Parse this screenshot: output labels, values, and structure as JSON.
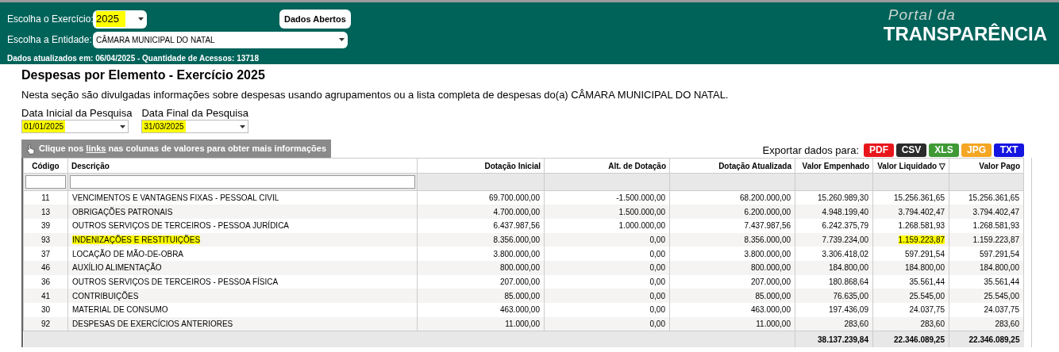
{
  "header": {
    "year_label": "Escolha o Exercício:",
    "year": {
      "value": "2025",
      "highlighted": true
    },
    "open_data_button": "Dados Abertos",
    "entity_label": "Escolha a Entidade:",
    "entity": "CÂMARA MUNICIPAL DO NATAL",
    "updated_info": "Dados atualizados em: 06/04/2025 - Quantidade de Acessos: 13718",
    "logo_small": "Portal da",
    "logo_large": "TRANSPARÊNCIA"
  },
  "page": {
    "title": "Despesas por Elemento - Exercício 2025",
    "description": "Nesta seção são divulgadas informações sobre despesas usando agrupamentos ou a lista completa de despesas do(a) CÂMARA MUNICIPAL DO NATAL.",
    "date_fields": [
      {
        "label": "Data Inicial da Pesquisa",
        "value": "01/01/2025",
        "highlighted": true
      },
      {
        "label": "Data Final da Pesquisa",
        "value": "31/03/2025",
        "highlighted": true
      }
    ],
    "hint": {
      "before": "Clique nos",
      "link": "links",
      "after": "nas colunas de valores para obter mais informações"
    },
    "export_label": "Exportar dados para:",
    "export_buttons": [
      {
        "label": "PDF",
        "color": "#e8161b"
      },
      {
        "label": "CSV",
        "color": "#2b2b2b"
      },
      {
        "label": "XLS",
        "color": "#3f9a35"
      },
      {
        "label": "JPG",
        "color": "#f5a623"
      },
      {
        "label": "TXT",
        "color": "#1515e0"
      }
    ]
  },
  "table": {
    "columns": [
      {
        "label": "Código",
        "sorted": false,
        "filter": true
      },
      {
        "label": "Descrição",
        "sorted": false,
        "filter": true
      },
      {
        "label": "Dotação Inicial",
        "sorted": false,
        "filter": false
      },
      {
        "label": "Alt. de Dotação",
        "sorted": false,
        "filter": false
      },
      {
        "label": "Dotação Atualizada",
        "sorted": false,
        "filter": false
      },
      {
        "label": "Valor Empenhado",
        "sorted": false,
        "filter": false
      },
      {
        "label": "Valor Liquidado",
        "sorted": true,
        "filter": false
      },
      {
        "label": "Valor Pago",
        "sorted": false,
        "filter": false
      }
    ],
    "sort_indicator": "▽",
    "rows": [
      {
        "cells": [
          {
            "text": "11",
            "highlighted": false
          },
          {
            "text": "VENCIMENTOS E VANTAGENS FIXAS - PESSOAL CIVIL",
            "highlighted": false
          },
          {
            "text": "69.700.000,00",
            "highlighted": false
          },
          {
            "text": "-1.500.000,00",
            "highlighted": false
          },
          {
            "text": "68.200.000,00",
            "highlighted": false
          },
          {
            "text": "15.260.989,30",
            "highlighted": false
          },
          {
            "text": "15.256.361,65",
            "highlighted": false
          },
          {
            "text": "15.256.361,65",
            "highlighted": false
          }
        ]
      },
      {
        "cells": [
          {
            "text": "13",
            "highlighted": false
          },
          {
            "text": "OBRIGAÇÕES PATRONAIS",
            "highlighted": false
          },
          {
            "text": "4.700.000,00",
            "highlighted": false
          },
          {
            "text": "1.500.000,00",
            "highlighted": false
          },
          {
            "text": "6.200.000,00",
            "highlighted": false
          },
          {
            "text": "4.948.199,40",
            "highlighted": false
          },
          {
            "text": "3.794.402,47",
            "highlighted": false
          },
          {
            "text": "3.794.402,47",
            "highlighted": false
          }
        ]
      },
      {
        "cells": [
          {
            "text": "39",
            "highlighted": false
          },
          {
            "text": "OUTROS SERVIÇOS DE TERCEIROS - PESSOA JURÍDICA",
            "highlighted": false
          },
          {
            "text": "6.437.987,56",
            "highlighted": false
          },
          {
            "text": "1.000.000,00",
            "highlighted": false
          },
          {
            "text": "7.437.987,56",
            "highlighted": false
          },
          {
            "text": "6.242.375,79",
            "highlighted": false
          },
          {
            "text": "1.268.581,93",
            "highlighted": false
          },
          {
            "text": "1.268.581,93",
            "highlighted": false
          }
        ]
      },
      {
        "cells": [
          {
            "text": "93",
            "highlighted": false
          },
          {
            "text": "INDENIZAÇÕES E RESTITUIÇÕES",
            "highlighted": true
          },
          {
            "text": "8.356.000,00",
            "highlighted": false
          },
          {
            "text": "0,00",
            "highlighted": false
          },
          {
            "text": "8.356.000,00",
            "highlighted": false
          },
          {
            "text": "7.739.234,00",
            "highlighted": false
          },
          {
            "text": "1.159.223,87",
            "highlighted": true
          },
          {
            "text": "1.159.223,87",
            "highlighted": false
          }
        ]
      },
      {
        "cells": [
          {
            "text": "37",
            "highlighted": false
          },
          {
            "text": "LOCAÇÃO DE MÃO-DE-OBRA",
            "highlighted": false
          },
          {
            "text": "3.800.000,00",
            "highlighted": false
          },
          {
            "text": "0,00",
            "highlighted": false
          },
          {
            "text": "3.800.000,00",
            "highlighted": false
          },
          {
            "text": "3.306.418,02",
            "highlighted": false
          },
          {
            "text": "597.291,54",
            "highlighted": false
          },
          {
            "text": "597.291,54",
            "highlighted": false
          }
        ]
      },
      {
        "cells": [
          {
            "text": "46",
            "highlighted": false
          },
          {
            "text": "AUXÍLIO ALIMENTAÇÃO",
            "highlighted": false
          },
          {
            "text": "800.000,00",
            "highlighted": false
          },
          {
            "text": "0,00",
            "highlighted": false
          },
          {
            "text": "800.000,00",
            "highlighted": false
          },
          {
            "text": "184.800,00",
            "highlighted": false
          },
          {
            "text": "184.800,00",
            "highlighted": false
          },
          {
            "text": "184.800,00",
            "highlighted": false
          }
        ]
      },
      {
        "cells": [
          {
            "text": "36",
            "highlighted": false
          },
          {
            "text": "OUTROS SERVIÇOS DE TERCEIROS - PESSOA FÍSICA",
            "highlighted": false
          },
          {
            "text": "207.000,00",
            "highlighted": false
          },
          {
            "text": "0,00",
            "highlighted": false
          },
          {
            "text": "207.000,00",
            "highlighted": false
          },
          {
            "text": "180.868,64",
            "highlighted": false
          },
          {
            "text": "35.561,44",
            "highlighted": false
          },
          {
            "text": "35.561,44",
            "highlighted": false
          }
        ]
      },
      {
        "cells": [
          {
            "text": "41",
            "highlighted": false
          },
          {
            "text": "CONTRIBUIÇÕES",
            "highlighted": false
          },
          {
            "text": "85.000,00",
            "highlighted": false
          },
          {
            "text": "0,00",
            "highlighted": false
          },
          {
            "text": "85.000,00",
            "highlighted": false
          },
          {
            "text": "76.635,00",
            "highlighted": false
          },
          {
            "text": "25.545,00",
            "highlighted": false
          },
          {
            "text": "25.545,00",
            "highlighted": false
          }
        ]
      },
      {
        "cells": [
          {
            "text": "30",
            "highlighted": false
          },
          {
            "text": "MATERIAL DE CONSUMO",
            "highlighted": false
          },
          {
            "text": "463.000,00",
            "highlighted": false
          },
          {
            "text": "0,00",
            "highlighted": false
          },
          {
            "text": "463.000,00",
            "highlighted": false
          },
          {
            "text": "197.436,09",
            "highlighted": false
          },
          {
            "text": "24.037,75",
            "highlighted": false
          },
          {
            "text": "24.037,75",
            "highlighted": false
          }
        ]
      },
      {
        "cells": [
          {
            "text": "92",
            "highlighted": false
          },
          {
            "text": "DESPESAS DE EXERCÍCIOS ANTERIORES",
            "highlighted": false
          },
          {
            "text": "11.000,00",
            "highlighted": false
          },
          {
            "text": "0,00",
            "highlighted": false
          },
          {
            "text": "11.000,00",
            "highlighted": false
          },
          {
            "text": "283,60",
            "highlighted": false
          },
          {
            "text": "283,60",
            "highlighted": false
          },
          {
            "text": "283,60",
            "highlighted": false
          }
        ]
      }
    ],
    "totals": {
      "valor_empenhado": "38.137.239,84",
      "valor_liquidado": "22.346.089,25",
      "valor_pago": "22.346.089,25"
    }
  }
}
